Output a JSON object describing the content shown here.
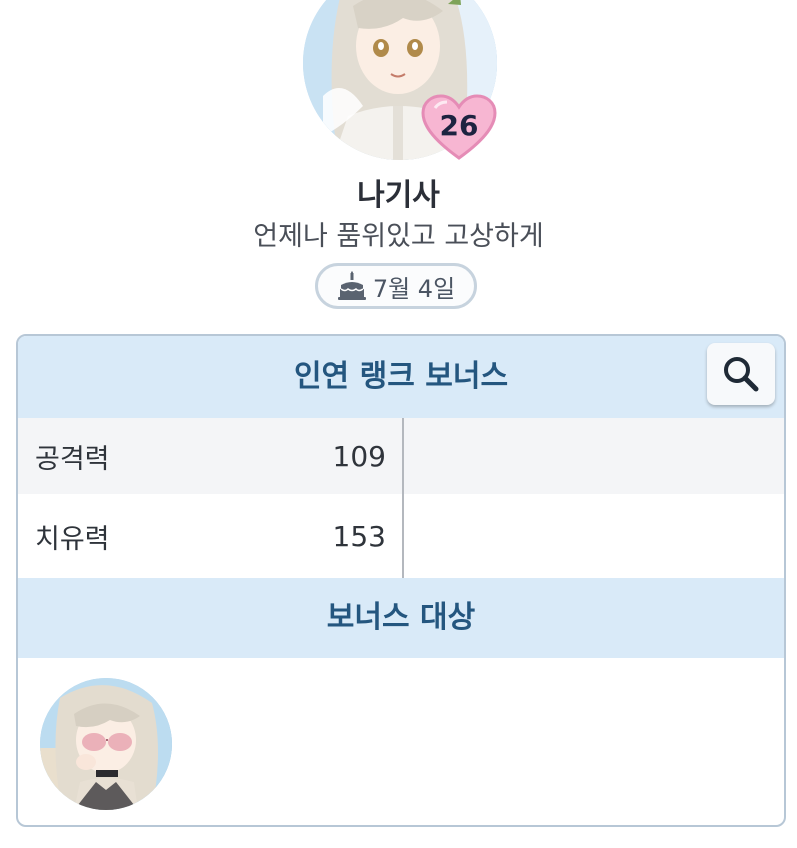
{
  "profile": {
    "affection_level": "26",
    "name": "나기사",
    "quote": "언제나 품위있고 고상하게",
    "birthday": "7월 4일"
  },
  "bonus_panel": {
    "title": "인연 랭크 보너스",
    "stats": [
      {
        "label": "공격력",
        "value": "109"
      },
      {
        "label": "치유력",
        "value": "153"
      }
    ],
    "target_section_title": "보너스 대상"
  },
  "colors": {
    "header_bg": "#d9eaf8",
    "header_text": "#24567f",
    "heart_pink": "#f4a7c8",
    "panel_border": "#b7c7d6"
  },
  "icons": {
    "search": "search-icon",
    "cake": "cake-icon",
    "heart": "heart-icon"
  }
}
